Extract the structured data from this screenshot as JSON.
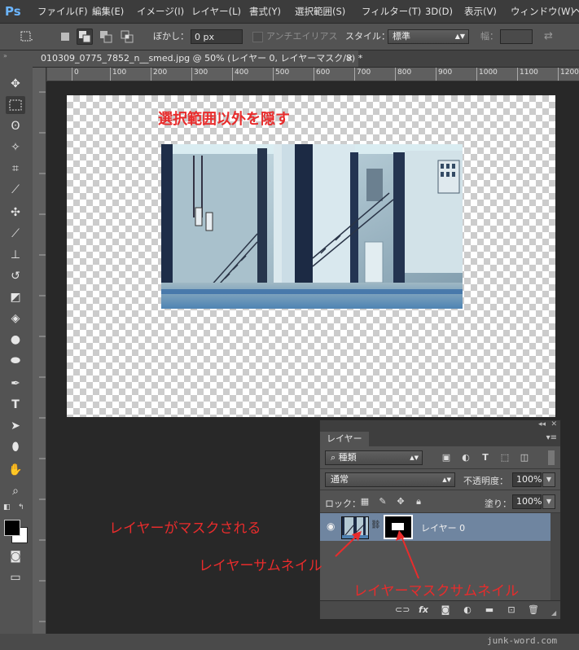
{
  "app": {
    "logo": "Ps",
    "menu": [
      "ファイル(F)",
      "編集(E)",
      "イメージ(I)",
      "レイヤー(L)",
      "書式(Y)",
      "選択範囲(S)",
      "フィルター(T)",
      "3D(D)",
      "表示(V)",
      "ウィンドウ(W)",
      "ヘ"
    ]
  },
  "options": {
    "feather_label": "ぼかし：",
    "feather_value": "0 px",
    "antialias_label": "アンチエイリアス",
    "style_label": "スタイル：",
    "style_value": "標準",
    "width_label": "幅："
  },
  "document": {
    "tab_title": "010309_0775_7852_n__smed.jpg @ 50% (レイヤー 0, レイヤーマスク/8) *",
    "close_glyph": "×"
  },
  "ruler": {
    "h_ticks": [
      "0",
      "100",
      "200",
      "300",
      "400",
      "500",
      "600",
      "700",
      "800",
      "900",
      "1000",
      "1100",
      "1200"
    ]
  },
  "annotations": {
    "hide_outside": "選択範囲以外を隠す",
    "layer_masked": "レイヤーがマスクされる",
    "layer_thumb": "レイヤーサムネイル",
    "mask_thumb": "レイヤーマスクサムネイル"
  },
  "layers_panel": {
    "tab_label": "レイヤー",
    "filter_kind": "種類",
    "blend_mode": "通常",
    "opacity_label": "不透明度：",
    "opacity_value": "100%",
    "lock_label": "ロック：",
    "fill_label": "塗り：",
    "fill_value": "100%",
    "layer_name": "レイヤー 0",
    "footer_icons": [
      "link-icon",
      "fx-icon",
      "mask-icon",
      "adjustment-icon",
      "folder-icon",
      "new-layer-icon",
      "trash-icon"
    ],
    "fx_text": "fx"
  },
  "watermark": "junk-word.com",
  "colors": {
    "annotation": "#e82c2c",
    "selected_layer": "#6f85a0"
  }
}
